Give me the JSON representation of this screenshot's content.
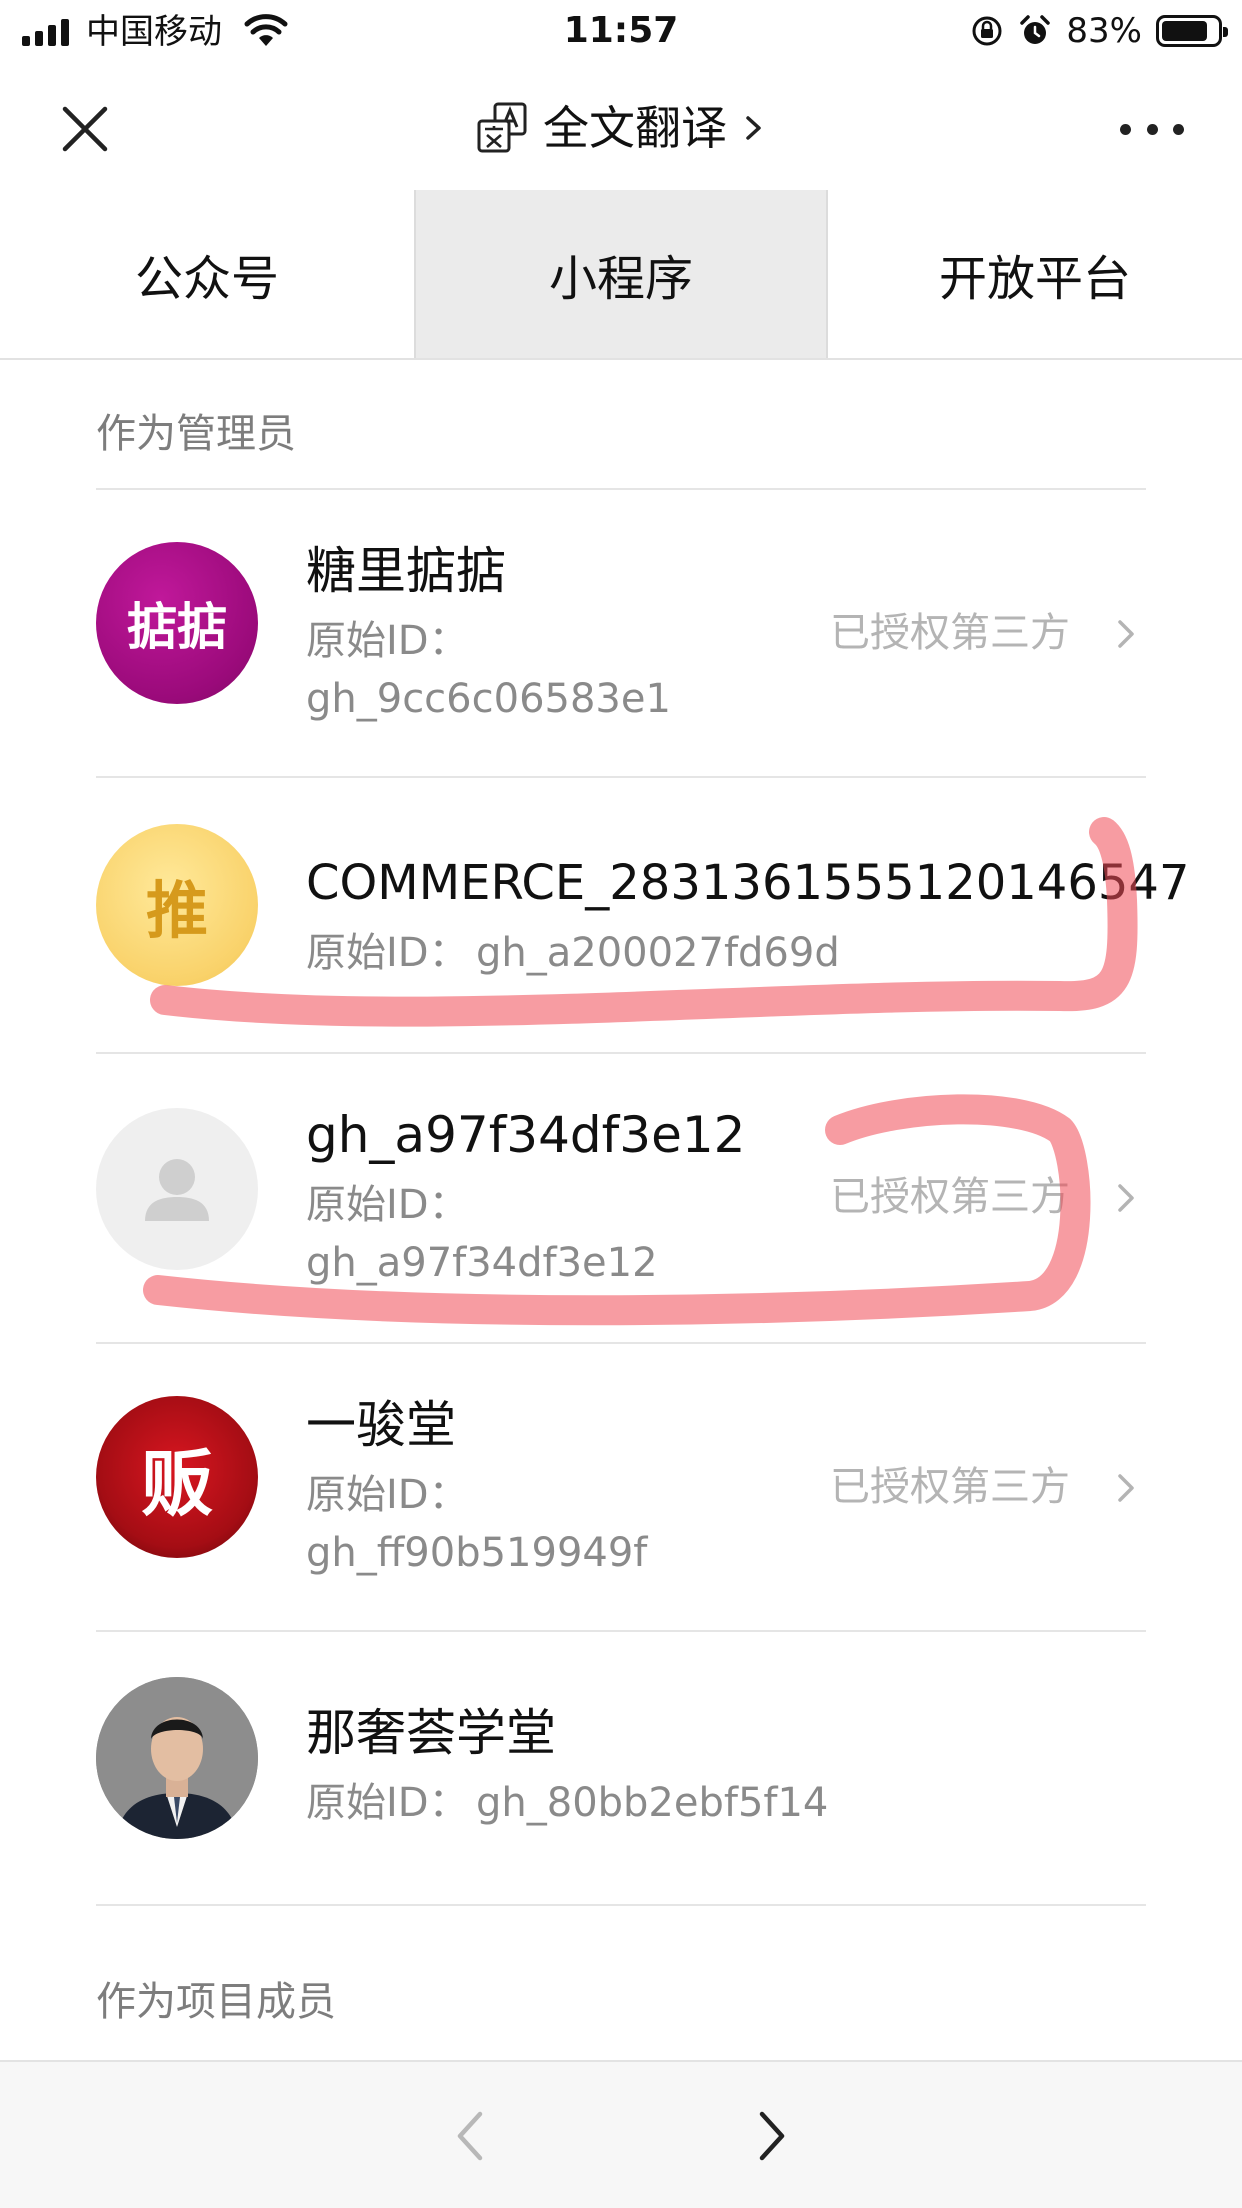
{
  "status_bar": {
    "carrier": "中国移动",
    "time": "11:57",
    "battery_percent": "83%",
    "battery_level": 0.83
  },
  "nav": {
    "title": "全文翻译",
    "close_icon": "close-icon",
    "translate_icon": "translate-icon",
    "more_icon": "more-icon"
  },
  "tabs": [
    {
      "label": "公众号",
      "active": false
    },
    {
      "label": "小程序",
      "active": true
    },
    {
      "label": "开放平台",
      "active": false
    }
  ],
  "sections": {
    "admin_title": "作为管理员",
    "member_title": "作为项目成员"
  },
  "items": [
    {
      "name": "糖里掂掂",
      "id_label": "原始ID：",
      "id_value": "gh_9cc6c06583e1",
      "status": "已授权第三方",
      "avatar_text": "掂掂"
    },
    {
      "name": "COMMERCE_283136155512014654​7",
      "id_label": "原始ID：",
      "id_value": "gh_a200027fd69d",
      "status": "",
      "avatar_text": "推"
    },
    {
      "name": "gh_a97f34df3e12",
      "id_label": "原始ID：",
      "id_value": "gh_a97f34df3e12",
      "status": "已授权第三方",
      "avatar_text": ""
    },
    {
      "name": "一骏堂",
      "id_label": "原始ID：",
      "id_value": "gh_ff90b519949f",
      "status": "已授权第三方",
      "avatar_text": "贩"
    },
    {
      "name": "那奢荟学堂",
      "id_label": "原始ID：",
      "id_value": "gh_80bb2ebf5f14",
      "status": "",
      "avatar_text": ""
    }
  ],
  "colors": {
    "scribble": "#f04b55",
    "tab_active_bg": "#ebebeb"
  }
}
